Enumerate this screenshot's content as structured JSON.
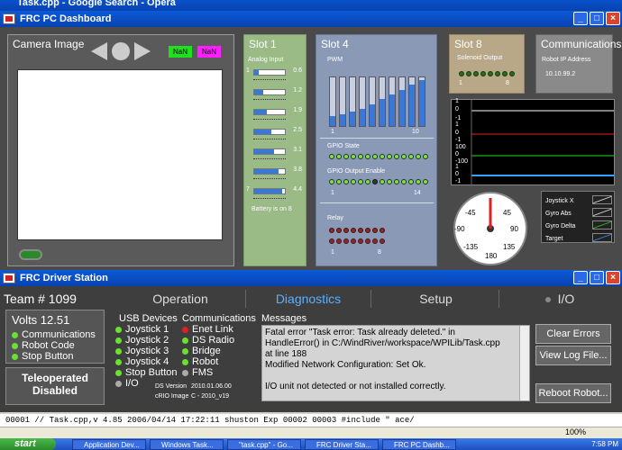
{
  "browser_title": "Task.cpp - Google Search - Opera",
  "dashboard": {
    "title": "FRC PC Dashboard",
    "camera": {
      "title": "Camera Image",
      "nan1": "NaN",
      "nan2": "NaN"
    },
    "slot1": {
      "title": "Slot 1",
      "subtitle": "Analog Input",
      "channels": [
        {
          "n": "1",
          "v": "0.6",
          "f": 0.15
        },
        {
          "n": "",
          "v": "1.2",
          "f": 0.28
        },
        {
          "n": "",
          "v": "1.9",
          "f": 0.42
        },
        {
          "n": "",
          "v": "2.5",
          "f": 0.55
        },
        {
          "n": "",
          "v": "3.1",
          "f": 0.65
        },
        {
          "n": "",
          "v": "3.8",
          "f": 0.78
        },
        {
          "n": "7",
          "v": "4.4",
          "f": 0.9
        }
      ],
      "battery": "Battery is on 8"
    },
    "slot4": {
      "title": "Slot 4",
      "pwm_label": "PWM",
      "pwm_levels": [
        0.2,
        0.25,
        0.3,
        0.35,
        0.45,
        0.55,
        0.65,
        0.75,
        0.85,
        0.95
      ],
      "pwm_lo": "1",
      "pwm_hi": "10",
      "gpio_state": "GPIO State",
      "gpio_enable": "GPIO Output Enable",
      "gpio_lo": "1",
      "gpio_hi": "14",
      "relay": "Relay",
      "relay_lo": "1",
      "relay_hi": "8"
    },
    "slot8": {
      "title": "Slot 8",
      "subtitle": "Solenoid Output",
      "lo": "1",
      "hi": "8"
    },
    "comms": {
      "title": "Communications",
      "ip_label": "Robot IP Address",
      "ip": "10.10.99.2"
    },
    "scope_labels": [
      "1",
      "0",
      "-1",
      "1",
      "0",
      "-1",
      "100",
      "0",
      "-100",
      "1",
      "0",
      "-1"
    ],
    "gauge": {
      "labels": [
        "0",
        "45",
        "-45",
        "90",
        "-90",
        "135",
        "-135",
        "180"
      ]
    },
    "gyro_legend": [
      "Joystick X",
      "Gyro Abs",
      "Gyro Delta",
      "Target"
    ]
  },
  "driver_station": {
    "title": "FRC Driver Station",
    "team": "Team # 1099",
    "tabs": [
      "Operation",
      "Diagnostics",
      "Setup",
      "I/O"
    ],
    "volts": "Volts  12.51",
    "status_items": [
      "Communications",
      "Robot Code",
      "Stop Button"
    ],
    "mode": "Teleoperated",
    "state": "Disabled",
    "usb_title": "USB Devices",
    "usb_items": [
      "Joystick 1",
      "Joystick 2",
      "Joystick 3",
      "Joystick 4",
      "Stop Button",
      "I/O"
    ],
    "comm_title": "Communications",
    "comm_items": [
      "Enet Link",
      "DS Radio",
      "Bridge",
      "Robot",
      "FMS"
    ],
    "ds_version_label": "DS Version",
    "ds_version": "2010.01.06.00",
    "crio_label": "cRIO Image",
    "crio": "C - 2010_v19",
    "messages_title": "Messages",
    "messages": [
      "Fatal error \"Task error: Task already deleted.\" in",
      "HandleError() in C:/WindRiver/workspace/WPILib/Task.cpp",
      "at line 188",
      "Modified Network Configuration: Set Ok.",
      "",
      "I/O unit not detected or not installed correctly."
    ],
    "buttons": [
      "Clear Errors",
      "View Log File...",
      "Reboot Robot..."
    ]
  },
  "code_line": "00001 // Task.cpp,v 4.85 2006/04/14 17:22:11 shuston Exp 00002 00003 #include \" ace/",
  "zoom": "100%",
  "taskbar": {
    "start": "start",
    "items": [
      "Application Dev...",
      "Windows Task...",
      "\"task.cpp\" - Go...",
      "FRC Driver Sta...",
      "FRC PC Dashb..."
    ],
    "clock": "7:58 PM"
  }
}
